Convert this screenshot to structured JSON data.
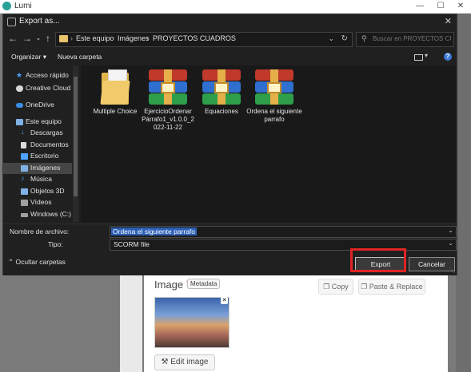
{
  "app": {
    "title": "Lumi"
  },
  "dialog": {
    "title": "Export as...",
    "breadcrumb": [
      "Este equipo",
      "Imágenes",
      "PROYECTOS CUADROS"
    ],
    "search_placeholder": "Buscar en PROYECTOS CUA...",
    "toolbar": {
      "organize": "Organizar",
      "new_folder": "Nueva carpeta"
    },
    "nav_items": [
      {
        "label": "Acceso rápido",
        "icon": "star-icon",
        "color": "#4da3ff"
      },
      {
        "label": "Creative Cloud Fil",
        "icon": "cloud-icon",
        "color": "#e0e0e0"
      },
      {
        "label": "OneDrive",
        "icon": "onedrive-icon",
        "color": "#3a8ee6"
      },
      {
        "label": "Este equipo",
        "icon": "computer-icon",
        "color": "#7fb3e6"
      },
      {
        "label": "Descargas",
        "icon": "download-icon",
        "color": "#4da3ff"
      },
      {
        "label": "Documentos",
        "icon": "documents-icon",
        "color": "#dcdcdc"
      },
      {
        "label": "Escritorio",
        "icon": "desktop-icon",
        "color": "#4da3ff"
      },
      {
        "label": "Imágenes",
        "icon": "pictures-icon",
        "color": "#7fb3e6"
      },
      {
        "label": "Música",
        "icon": "music-icon",
        "color": "#4da3ff"
      },
      {
        "label": "Objetos 3D",
        "icon": "cube-icon",
        "color": "#7fb3e6"
      },
      {
        "label": "Vídeos",
        "icon": "video-icon",
        "color": "#a0a0a0"
      },
      {
        "label": "Windows (C:)",
        "icon": "drive-icon",
        "color": "#a0a0a0"
      }
    ],
    "selected_nav": "Imágenes",
    "files": [
      {
        "name": "Multiple Choice",
        "type": "folder"
      },
      {
        "name": "EjercicioOrdenar Párrafo1_v1.0.0_2 022-11-22",
        "type": "rar"
      },
      {
        "name": "Equaciones",
        "type": "rar"
      },
      {
        "name": "Ordena el siguiente parrafo",
        "type": "rar"
      }
    ],
    "filename_label": "Nombre de archivo:",
    "filename_value": "Ordena el siguiente parrafo",
    "type_label": "Tipo:",
    "type_value": "SCORM file",
    "hide_folders": "Ocultar carpetas",
    "export_button": "Export",
    "cancel_button": "Cancelar"
  },
  "background": {
    "image_label": "Image",
    "metadata_badge": "Metadata",
    "copy_button": "Copy",
    "paste_button": "Paste & Replace",
    "edit_image_button": "Edit image"
  },
  "colors": {
    "highlight": "#e02424",
    "selection": "#2b5fb5",
    "accent": "#3d7bd9"
  }
}
